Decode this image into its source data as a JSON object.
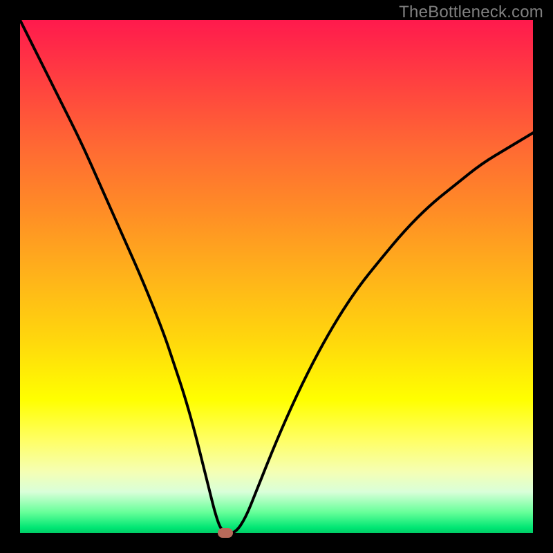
{
  "watermark": "TheBottleneck.com",
  "chart_data": {
    "type": "line",
    "title": "",
    "xlabel": "",
    "ylabel": "",
    "xlim": [
      0,
      100
    ],
    "ylim": [
      0,
      100
    ],
    "grid": false,
    "legend": false,
    "background": "rainbow-vertical-gradient",
    "series": [
      {
        "name": "bottleneck-curve",
        "x": [
          0,
          4,
          8,
          12,
          16,
          20,
          24,
          28,
          30,
          32,
          34,
          36,
          37,
          38,
          39,
          40,
          42,
          44,
          46,
          50,
          54,
          58,
          62,
          66,
          70,
          75,
          80,
          85,
          90,
          95,
          100
        ],
        "y": [
          100,
          92,
          84,
          76,
          67,
          58,
          49,
          39,
          33,
          27,
          20,
          12,
          8,
          4,
          1,
          0,
          0,
          3,
          8,
          18,
          27,
          35,
          42,
          48,
          53,
          59,
          64,
          68,
          72,
          75,
          78
        ]
      }
    ],
    "marker": {
      "x": 40,
      "y": 0,
      "color": "#b86a5a",
      "shape": "rounded-rect"
    }
  }
}
